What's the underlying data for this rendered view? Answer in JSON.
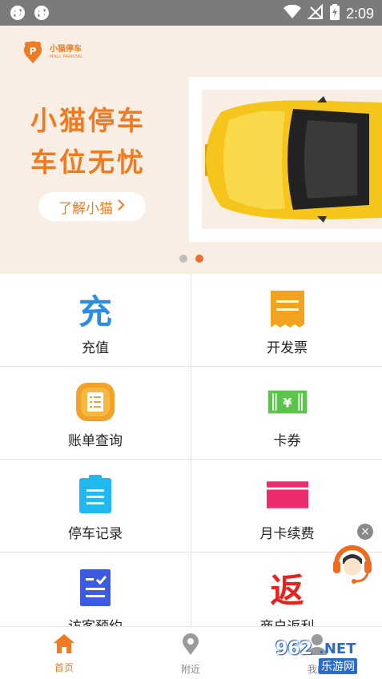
{
  "status_bar": {
    "time": "2:09",
    "icons": [
      "sync-icon",
      "sync-icon",
      "wifi-icon",
      "no-signal-icon",
      "battery-charging-icon"
    ]
  },
  "banner": {
    "logo": {
      "cn": "小猫停车",
      "en": "MALL PARKING"
    },
    "slogan_line1": "小猫停车",
    "slogan_line2": "车位无忧",
    "learn_button": "了解小猫",
    "active_slide": 2,
    "slide_count": 2
  },
  "grid": {
    "items": [
      {
        "label": "充值",
        "icon": "recharge-icon",
        "glyph": "充"
      },
      {
        "label": "开发票",
        "icon": "invoice-icon"
      },
      {
        "label": "账单查询",
        "icon": "bill-query-icon"
      },
      {
        "label": "卡券",
        "icon": "coupon-icon",
        "glyph": "¥"
      },
      {
        "label": "停车记录",
        "icon": "parking-record-icon"
      },
      {
        "label": "月卡续费",
        "icon": "monthly-card-icon"
      },
      {
        "label": "访客预约",
        "icon": "visitor-booking-icon"
      },
      {
        "label": "商户返利",
        "icon": "merchant-rebate-icon",
        "glyph": "返"
      }
    ]
  },
  "floating": {
    "close": "×",
    "icon": "customer-service-icon"
  },
  "bottom_nav": {
    "items": [
      {
        "label": "首页",
        "icon": "home-icon",
        "active": true
      },
      {
        "label": "附近",
        "icon": "location-pin-icon",
        "active": false
      },
      {
        "label": "我的",
        "icon": "user-icon",
        "active": false
      }
    ]
  },
  "watermark": {
    "number": "962",
    "domain": ".NET",
    "cn": "乐游网"
  },
  "colors": {
    "accent": "#ee7a22",
    "banner_bg": "#f8eee3",
    "status_bar": "#7b7b7b",
    "blue": "#2a8ee8",
    "red": "#e8231f",
    "green": "#5bc44a",
    "pink": "#ec2a6e"
  }
}
